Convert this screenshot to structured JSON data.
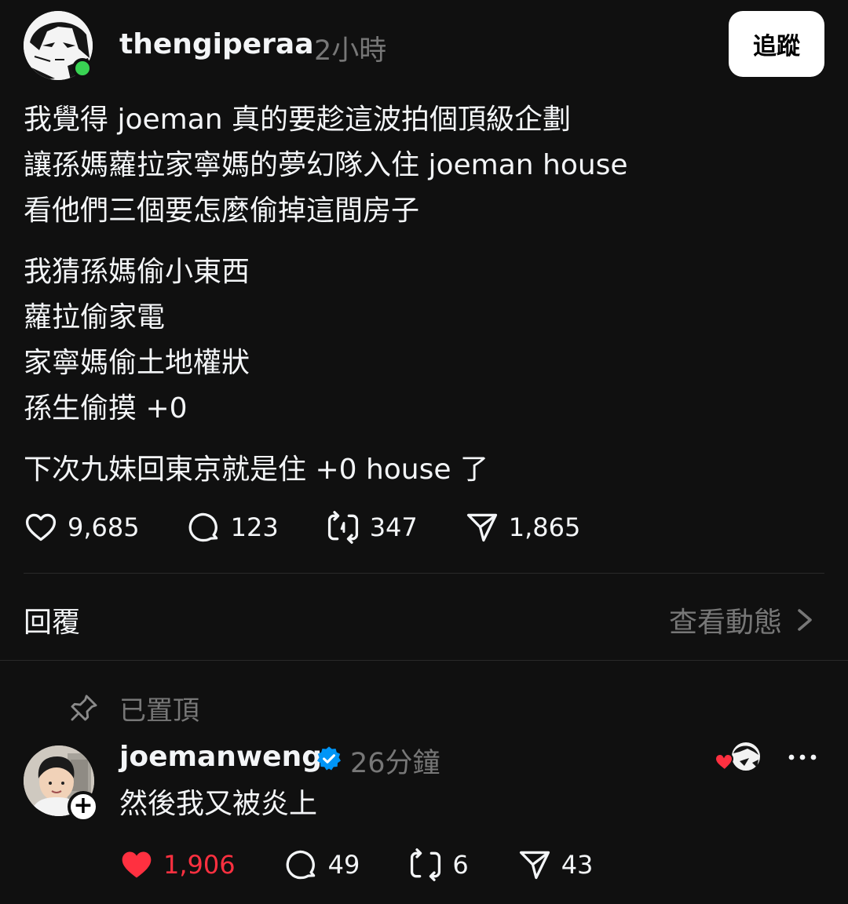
{
  "post": {
    "username": "thengiperaa",
    "time": "2小時",
    "follow_label": "追蹤",
    "paragraphs": [
      [
        "我覺得 joeman 真的要趁這波拍個頂級企劃",
        "讓孫媽蘿拉家寧媽的夢幻隊入住 joeman house",
        "看他們三個要怎麼偷掉這間房子"
      ],
      [
        "我猜孫媽偷小東西",
        "蘿拉偷家電",
        "家寧媽偷土地權狀",
        "孫生偷摸 +0"
      ],
      [
        "下次九妹回東京就是住 +0 house 了"
      ]
    ],
    "likes": "9,685",
    "comments": "123",
    "reposts": "347",
    "shares": "1,865"
  },
  "reply_bar": {
    "reply_label": "回覆",
    "view_activity_label": "查看動態"
  },
  "pinned_label": "已置頂",
  "reply": {
    "username": "joemanweng",
    "time": "26分鐘",
    "text": "然後我又被炎上",
    "likes": "1,906",
    "comments": "49",
    "reposts": "6",
    "shares": "43"
  },
  "colors": {
    "background": "#101010",
    "text": "#f3f5f7",
    "muted": "#777777",
    "like_red": "#ff3040",
    "verified_blue": "#0095f6",
    "online_green": "#39d353"
  },
  "icons": [
    "heart-icon",
    "comment-icon",
    "repost-icon",
    "share-icon",
    "chevron-right-icon",
    "pin-icon",
    "verified-icon",
    "more-icon",
    "plus-icon"
  ]
}
